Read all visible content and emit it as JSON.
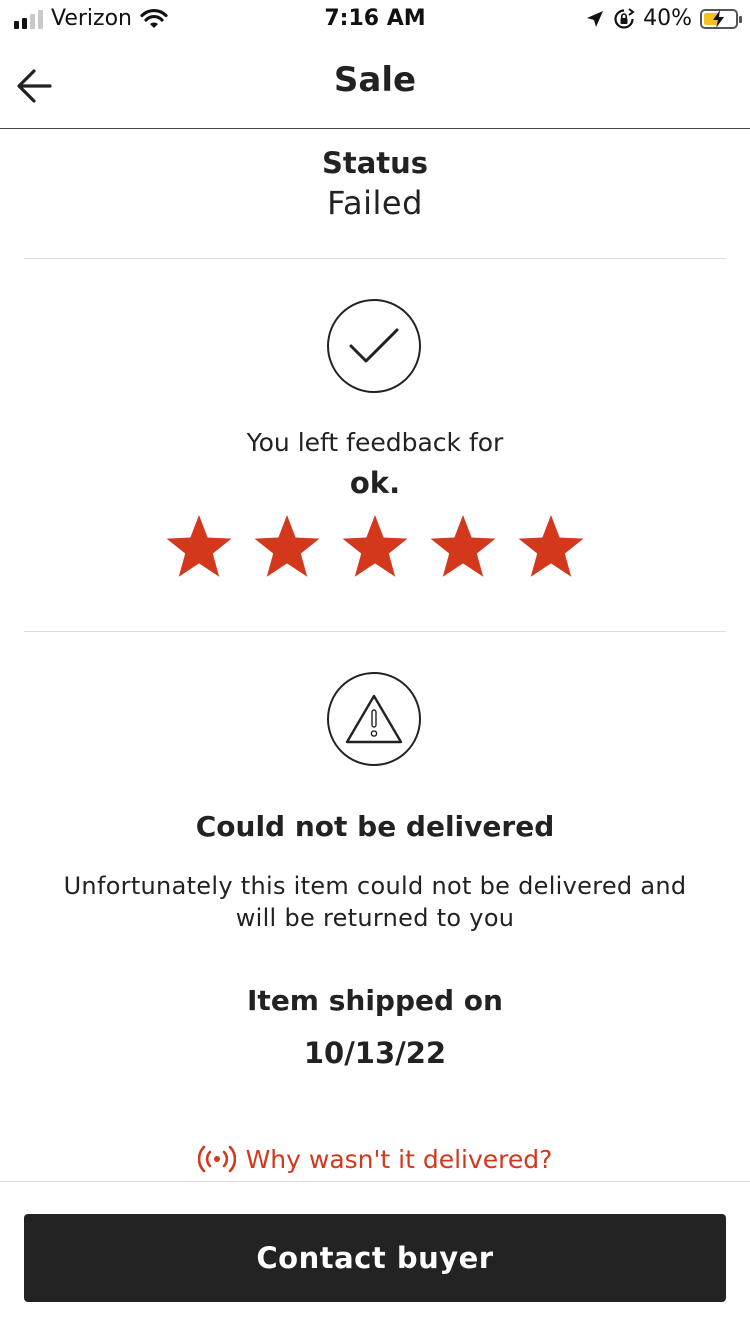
{
  "status_bar": {
    "carrier": "Verizon",
    "time": "7:16 AM",
    "battery_percent": "40%",
    "icons": [
      "cellular-signal-icon",
      "wifi-icon",
      "location-arrow-icon",
      "orientation-lock-icon",
      "battery-charging-icon"
    ]
  },
  "nav": {
    "title": "Sale",
    "back_icon": "arrow-left-icon"
  },
  "status": {
    "label": "Status",
    "value": "Failed"
  },
  "feedback": {
    "icon": "checkmark-circle-icon",
    "text": "You left feedback for",
    "buyer": "ok.",
    "rating": 5,
    "max_rating": 5,
    "star_color": "#d3381c"
  },
  "delivery": {
    "icon": "warning-triangle-icon",
    "title": "Could not be delivered",
    "message": "Unfortunately this item could not be delivered and will be returned to you"
  },
  "shipping": {
    "label": "Item shipped on",
    "date": "10/13/22"
  },
  "help_link": {
    "icon": "signal-broadcast-icon",
    "text": "Why wasn't it delivered?",
    "color": "#d3381c"
  },
  "action": {
    "contact_label": "Contact buyer"
  }
}
